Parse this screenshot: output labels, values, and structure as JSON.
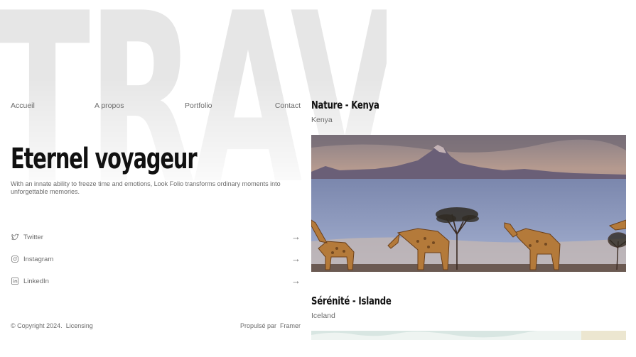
{
  "background_word": "TRAVELS",
  "nav": {
    "items": [
      {
        "label": "Accueil"
      },
      {
        "label": "A propos"
      },
      {
        "label": "Portfolio"
      },
      {
        "label": "Contact"
      }
    ]
  },
  "hero": {
    "title": "Eternel voyageur",
    "subtitle": "With an innate ability to freeze time and emotions, Look Folio transforms ordinary moments into unforgettable memories."
  },
  "social": {
    "items": [
      {
        "label": "Twitter",
        "icon": "twitter-bird-icon"
      },
      {
        "label": "Instagram",
        "icon": "instagram-icon"
      },
      {
        "label": "LinkedIn",
        "icon": "linkedin-icon"
      }
    ],
    "arrow_icon": "arrow-right-icon"
  },
  "footer": {
    "copyright": "© Copyright 2024.",
    "licensing": "Licensing",
    "powered_prefix": "Propulsé par",
    "powered_by": "Framer"
  },
  "cards": [
    {
      "title": "Nature - Kenya",
      "subtitle": "Kenya"
    },
    {
      "title": "Sérénité - Islande",
      "subtitle": "Iceland"
    }
  ],
  "colors": {
    "background": "#ffffff",
    "text_dark": "#111111",
    "text_muted": "#6b6b6b",
    "watermark": "#e6e6e6"
  }
}
